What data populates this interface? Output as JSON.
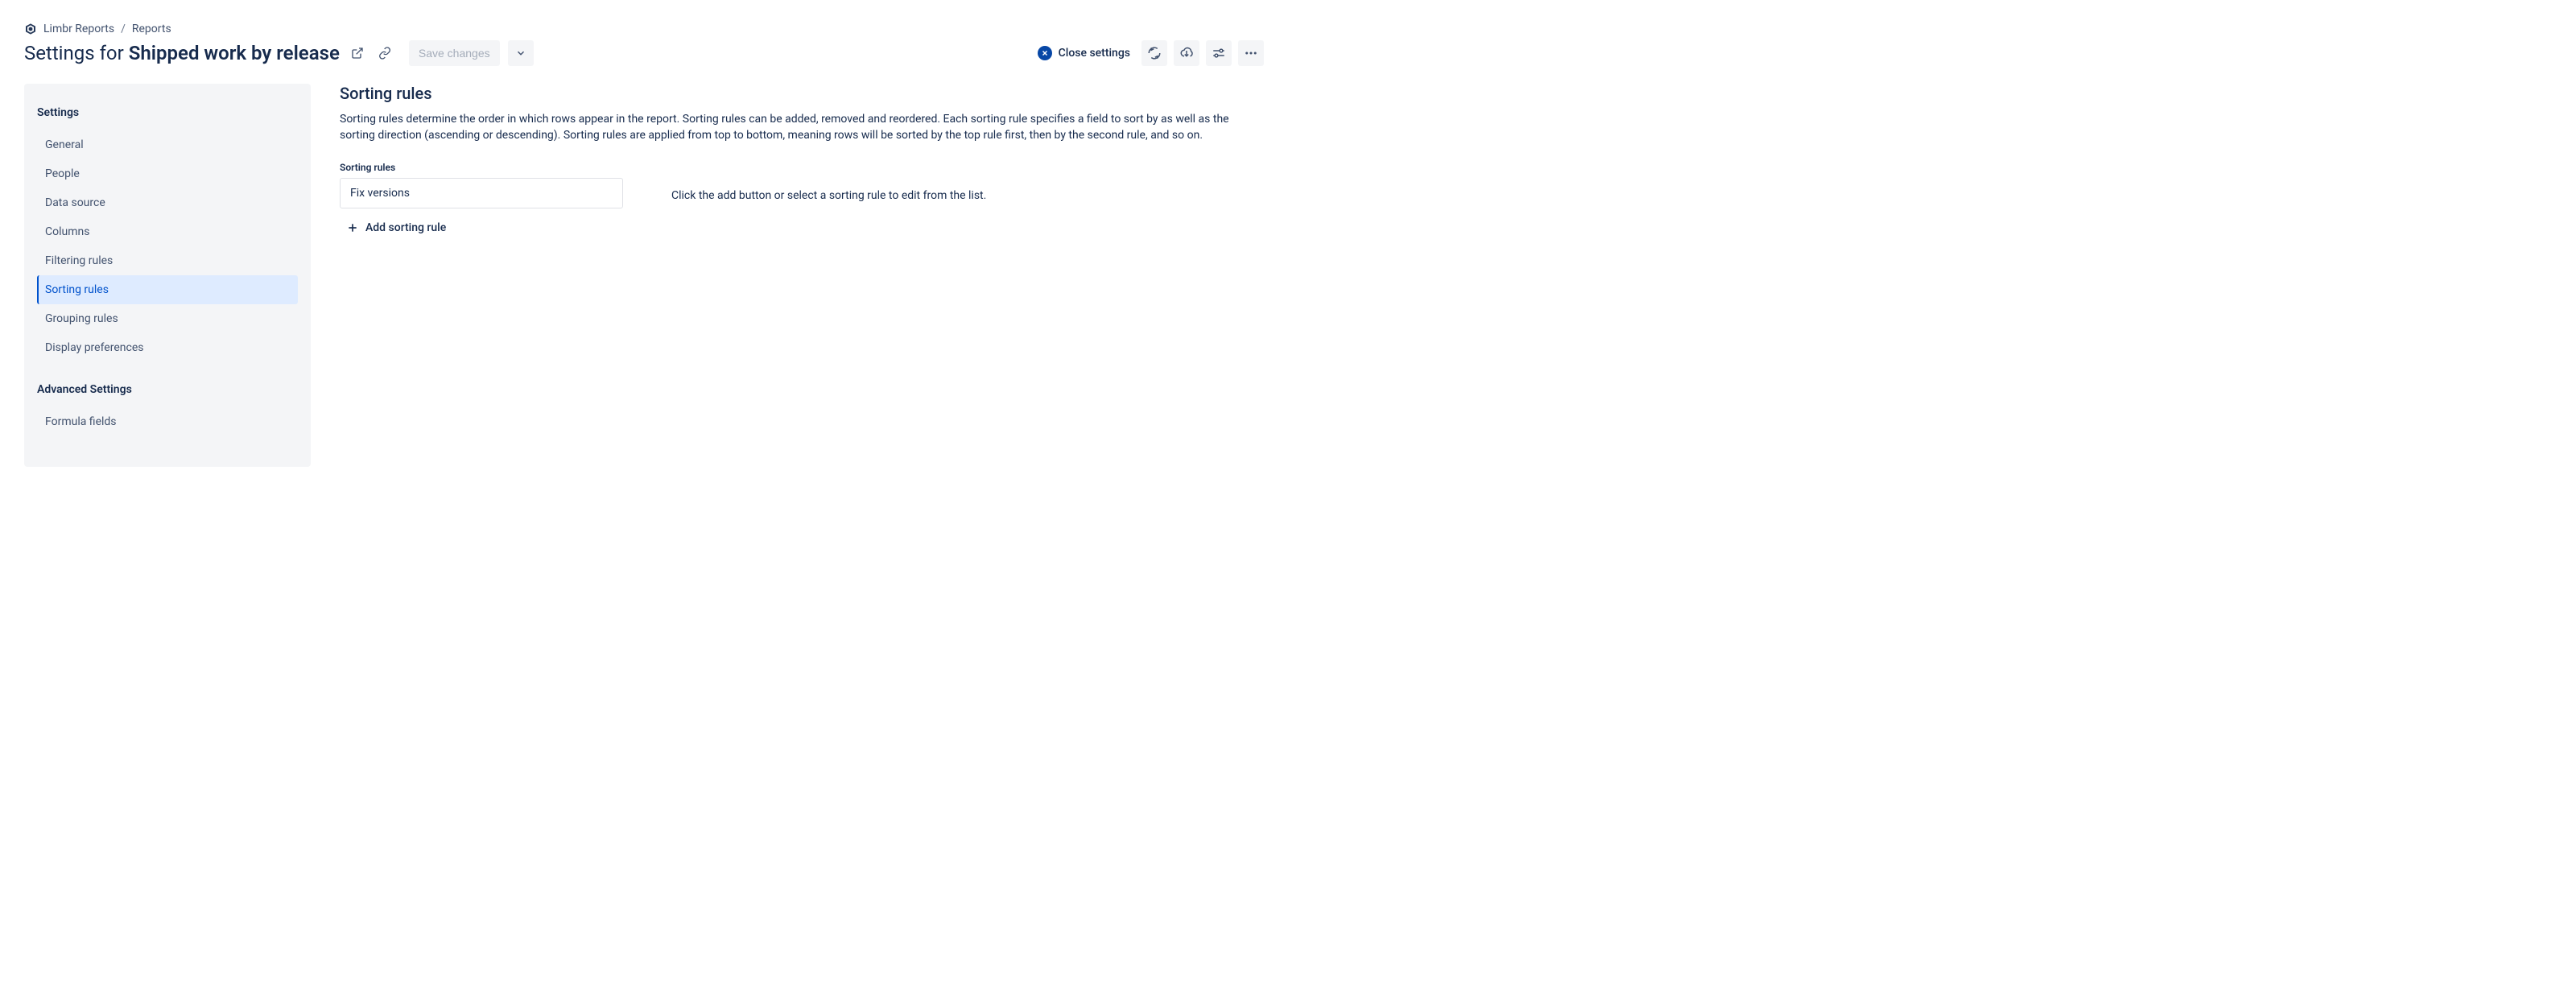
{
  "breadcrumbs": {
    "app": "Limbr Reports",
    "section": "Reports"
  },
  "header": {
    "title_prefix": "Settings for",
    "title_bold": "Shipped work by release",
    "save_label": "Save changes",
    "close_label": "Close settings"
  },
  "sidebar": {
    "section1_title": "Settings",
    "section1_items": [
      {
        "label": "General",
        "selected": false
      },
      {
        "label": "People",
        "selected": false
      },
      {
        "label": "Data source",
        "selected": false
      },
      {
        "label": "Columns",
        "selected": false
      },
      {
        "label": "Filtering rules",
        "selected": false
      },
      {
        "label": "Sorting rules",
        "selected": true
      },
      {
        "label": "Grouping rules",
        "selected": false
      },
      {
        "label": "Display preferences",
        "selected": false
      }
    ],
    "section2_title": "Advanced Settings",
    "section2_items": [
      {
        "label": "Formula fields",
        "selected": false
      }
    ]
  },
  "main": {
    "heading": "Sorting rules",
    "description": "Sorting rules determine the order in which rows appear in the report. Sorting rules can be added, removed and reordered. Each sorting rule specifies a field to sort by as well as the sorting direction (ascending or descending). Sorting rules are applied from top to bottom, meaning rows will be sorted by the top rule first, then by the second rule, and so on.",
    "rules_label": "Sorting rules",
    "rules": [
      {
        "label": "Fix versions"
      }
    ],
    "add_rule_label": "Add sorting rule",
    "placeholder_text": "Click the add button or select a sorting rule to edit from the list."
  }
}
